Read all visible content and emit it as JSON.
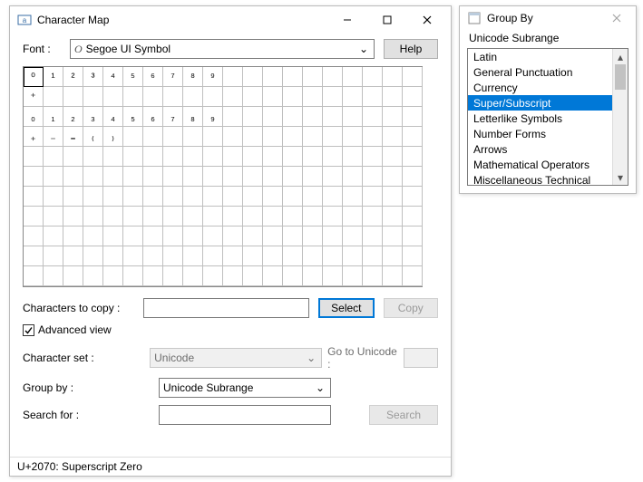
{
  "main": {
    "title": "Character Map",
    "font_label": "Font :",
    "font_value": "Segoe UI Symbol",
    "help_label": "Help",
    "grid_chars": {
      "row0": [
        "⁰",
        "¹",
        "²",
        "³",
        "⁴",
        "⁵",
        "⁶",
        "⁷",
        "⁸",
        "⁹"
      ],
      "row1": [
        "⁺"
      ],
      "row2": [
        "₀",
        "₁",
        "₂",
        "₃",
        "₄",
        "₅",
        "₆",
        "₇",
        "₈",
        "₉"
      ],
      "row3": [
        "₊",
        "₋",
        "₌",
        "₍",
        "₎"
      ]
    },
    "copy_label": "Characters to copy :",
    "select_label": "Select",
    "copy_btn_label": "Copy",
    "advanced_label": "Advanced view",
    "charset_label": "Character set :",
    "charset_value": "Unicode",
    "gotounicode_label": "Go to Unicode :",
    "groupby_label": "Group by :",
    "groupby_value": "Unicode Subrange",
    "search_label": "Search for :",
    "search_btn_label": "Search",
    "status": "U+2070: Superscript Zero"
  },
  "groupwin": {
    "title": "Group By",
    "header": "Unicode Subrange",
    "items": [
      "Latin",
      "General Punctuation",
      "Currency",
      "Super/Subscript",
      "Letterlike Symbols",
      "Number Forms",
      "Arrows",
      "Mathematical Operators",
      "Miscellaneous Technical"
    ],
    "selected_index": 3
  }
}
